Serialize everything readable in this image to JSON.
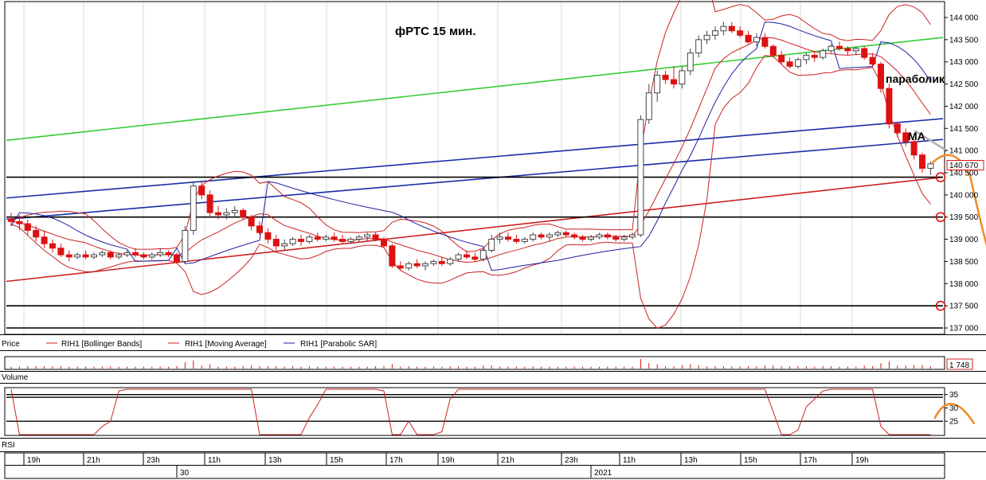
{
  "chart_data": {
    "type": "candlestick",
    "title": "фРТС   15 мин.",
    "instrument": "RIH1",
    "annotations": {
      "parabolic": "параболик",
      "ma": "МА"
    },
    "price_panel": {
      "ylim": [
        137000,
        144000
      ],
      "yticks": [
        137000,
        137500,
        138000,
        138500,
        139000,
        139500,
        140000,
        140500,
        141000,
        141500,
        142000,
        142500,
        143000,
        143500,
        144000
      ],
      "ytick_labels": [
        "137 000",
        "137 500",
        "138 000",
        "138 500",
        "139 000",
        "139 500",
        "140 000",
        "140 500",
        "141 000",
        "141 500",
        "142 000",
        "142 500",
        "143 000",
        "143 500",
        "144 000"
      ],
      "last_price_label": "140 670",
      "last_price": 140670,
      "horizontal_levels": [
        140400,
        139500,
        137500,
        137000
      ],
      "candles_ohlc": [
        [
          139450,
          139600,
          139300,
          139400
        ],
        [
          139400,
          139550,
          139200,
          139350
        ],
        [
          139350,
          139450,
          139100,
          139200
        ],
        [
          139200,
          139300,
          138950,
          139050
        ],
        [
          139050,
          139200,
          138800,
          138900
        ],
        [
          138900,
          139000,
          138700,
          138800
        ],
        [
          138800,
          138900,
          138600,
          138650
        ],
        [
          138650,
          138750,
          138500,
          138600
        ],
        [
          138600,
          138700,
          138550,
          138650
        ],
        [
          138650,
          138750,
          138550,
          138600
        ],
        [
          138600,
          138700,
          138550,
          138650
        ],
        [
          138650,
          138750,
          138600,
          138700
        ],
        [
          138700,
          138750,
          138550,
          138600
        ],
        [
          138600,
          138700,
          138550,
          138650
        ],
        [
          138650,
          138750,
          138600,
          138700
        ],
        [
          138700,
          138800,
          138600,
          138650
        ],
        [
          138650,
          138700,
          138550,
          138600
        ],
        [
          138600,
          138700,
          138550,
          138650
        ],
        [
          138650,
          138800,
          138600,
          138700
        ],
        [
          138700,
          138750,
          138600,
          138650
        ],
        [
          138650,
          138700,
          138450,
          138500
        ],
        [
          138500,
          139300,
          138450,
          139200
        ],
        [
          139200,
          140300,
          139100,
          140200
        ],
        [
          140200,
          140300,
          139900,
          140000
        ],
        [
          140000,
          140100,
          139500,
          139600
        ],
        [
          139600,
          139750,
          139450,
          139550
        ],
        [
          139550,
          139700,
          139450,
          139600
        ],
        [
          139600,
          139750,
          139500,
          139650
        ],
        [
          139650,
          139700,
          139450,
          139500
        ],
        [
          139500,
          139550,
          139200,
          139300
        ],
        [
          139300,
          139400,
          139100,
          139150
        ],
        [
          139150,
          139250,
          138900,
          139000
        ],
        [
          139000,
          139100,
          138750,
          138850
        ],
        [
          138850,
          139000,
          138750,
          138900
        ],
        [
          138900,
          139050,
          138850,
          139000
        ],
        [
          139000,
          139100,
          138850,
          138950
        ],
        [
          138950,
          139100,
          138900,
          139050
        ],
        [
          139050,
          139150,
          138950,
          139000
        ],
        [
          139000,
          139100,
          138950,
          139050
        ],
        [
          139050,
          139150,
          138950,
          139000
        ],
        [
          139000,
          139100,
          138900,
          138950
        ],
        [
          138950,
          139050,
          138900,
          139000
        ],
        [
          139000,
          139100,
          138950,
          139050
        ],
        [
          139050,
          139150,
          138950,
          139100
        ],
        [
          139100,
          139150,
          138950,
          139000
        ],
        [
          139000,
          139050,
          138800,
          138850
        ],
        [
          138850,
          138900,
          138350,
          138400
        ],
        [
          138400,
          138500,
          138300,
          138350
        ],
        [
          138350,
          138500,
          138300,
          138450
        ],
        [
          138450,
          138550,
          138350,
          138400
        ],
        [
          138400,
          138500,
          138300,
          138450
        ],
        [
          138450,
          138550,
          138400,
          138500
        ],
        [
          138500,
          138600,
          138400,
          138450
        ],
        [
          138450,
          138600,
          138400,
          138550
        ],
        [
          138550,
          138700,
          138500,
          138650
        ],
        [
          138650,
          138750,
          138550,
          138600
        ],
        [
          138600,
          138700,
          138500,
          138550
        ],
        [
          138550,
          138800,
          138500,
          138750
        ],
        [
          138750,
          139100,
          138700,
          139000
        ],
        [
          139000,
          139150,
          138900,
          139050
        ],
        [
          139050,
          139150,
          138950,
          139000
        ],
        [
          139000,
          139100,
          138900,
          138950
        ],
        [
          138950,
          139050,
          138900,
          139000
        ],
        [
          139000,
          139150,
          138950,
          139100
        ],
        [
          139100,
          139150,
          139000,
          139050
        ],
        [
          139050,
          139150,
          138950,
          139100
        ],
        [
          139100,
          139200,
          139050,
          139150
        ],
        [
          139150,
          139200,
          139050,
          139100
        ],
        [
          139100,
          139150,
          139000,
          139050
        ],
        [
          139050,
          139100,
          138950,
          139000
        ],
        [
          139000,
          139100,
          138950,
          139050
        ],
        [
          139050,
          139150,
          139000,
          139100
        ],
        [
          139100,
          139150,
          139000,
          139050
        ],
        [
          139050,
          139100,
          138950,
          139000
        ],
        [
          139000,
          139100,
          138950,
          139050
        ],
        [
          139050,
          139150,
          139000,
          139100
        ],
        [
          139100,
          141800,
          139050,
          141700
        ],
        [
          141700,
          142500,
          141600,
          142300
        ],
        [
          142300,
          142800,
          142100,
          142700
        ],
        [
          142700,
          142800,
          142500,
          142600
        ],
        [
          142600,
          142900,
          142400,
          142500
        ],
        [
          142500,
          142900,
          142400,
          142800
        ],
        [
          142800,
          143300,
          142700,
          143200
        ],
        [
          143200,
          143600,
          143100,
          143500
        ],
        [
          143500,
          143700,
          143400,
          143600
        ],
        [
          143600,
          143800,
          143500,
          143700
        ],
        [
          143700,
          143900,
          143600,
          143800
        ],
        [
          143800,
          143900,
          143650,
          143700
        ],
        [
          143700,
          143800,
          143550,
          143600
        ],
        [
          143600,
          143700,
          143400,
          143450
        ],
        [
          143450,
          143650,
          143350,
          143550
        ],
        [
          143550,
          143650,
          143300,
          143350
        ],
        [
          143350,
          143400,
          143100,
          143150
        ],
        [
          143150,
          143250,
          142950,
          143000
        ],
        [
          143000,
          143100,
          142850,
          142900
        ],
        [
          142900,
          143100,
          142850,
          143050
        ],
        [
          143050,
          143200,
          142950,
          143150
        ],
        [
          143150,
          143250,
          143000,
          143100
        ],
        [
          143100,
          143300,
          143050,
          143250
        ],
        [
          143250,
          143400,
          143200,
          143350
        ],
        [
          143350,
          143450,
          143250,
          143300
        ],
        [
          143300,
          143350,
          143150,
          143250
        ],
        [
          143250,
          143350,
          143150,
          143300
        ],
        [
          143300,
          143350,
          143050,
          143100
        ],
        [
          143100,
          143200,
          142900,
          142950
        ],
        [
          142950,
          143000,
          142300,
          142400
        ],
        [
          142400,
          142500,
          141500,
          141600
        ],
        [
          141600,
          141650,
          141300,
          141400
        ],
        [
          141400,
          141500,
          141100,
          141200
        ],
        [
          141200,
          141250,
          140800,
          140900
        ],
        [
          140900,
          140950,
          140500,
          140600
        ],
        [
          140600,
          140750,
          140450,
          140700
        ]
      ]
    },
    "legend": [
      "Price",
      "RIH1 [Bollinger Bands]",
      "RIH1 [Moving Average]",
      "RIH1 [Parabolic SAR]"
    ],
    "volume_panel": {
      "label": "Volume",
      "last_value_label": "1 748"
    },
    "rsi_panel": {
      "label": "RSI",
      "ylim": [
        20,
        37
      ],
      "yticks": [
        25,
        30,
        35
      ],
      "ytick_labels": [
        "25",
        "30",
        "35"
      ],
      "levels": [
        35,
        34,
        25
      ]
    },
    "time_axis": {
      "hour_labels": [
        "19h",
        "21h",
        "23h",
        "11h",
        "13h",
        "15h",
        "17h",
        "19h",
        "21h",
        "23h",
        "11h",
        "13h",
        "15h",
        "17h",
        "19h"
      ],
      "day_labels": [
        "30",
        "2021"
      ]
    }
  }
}
